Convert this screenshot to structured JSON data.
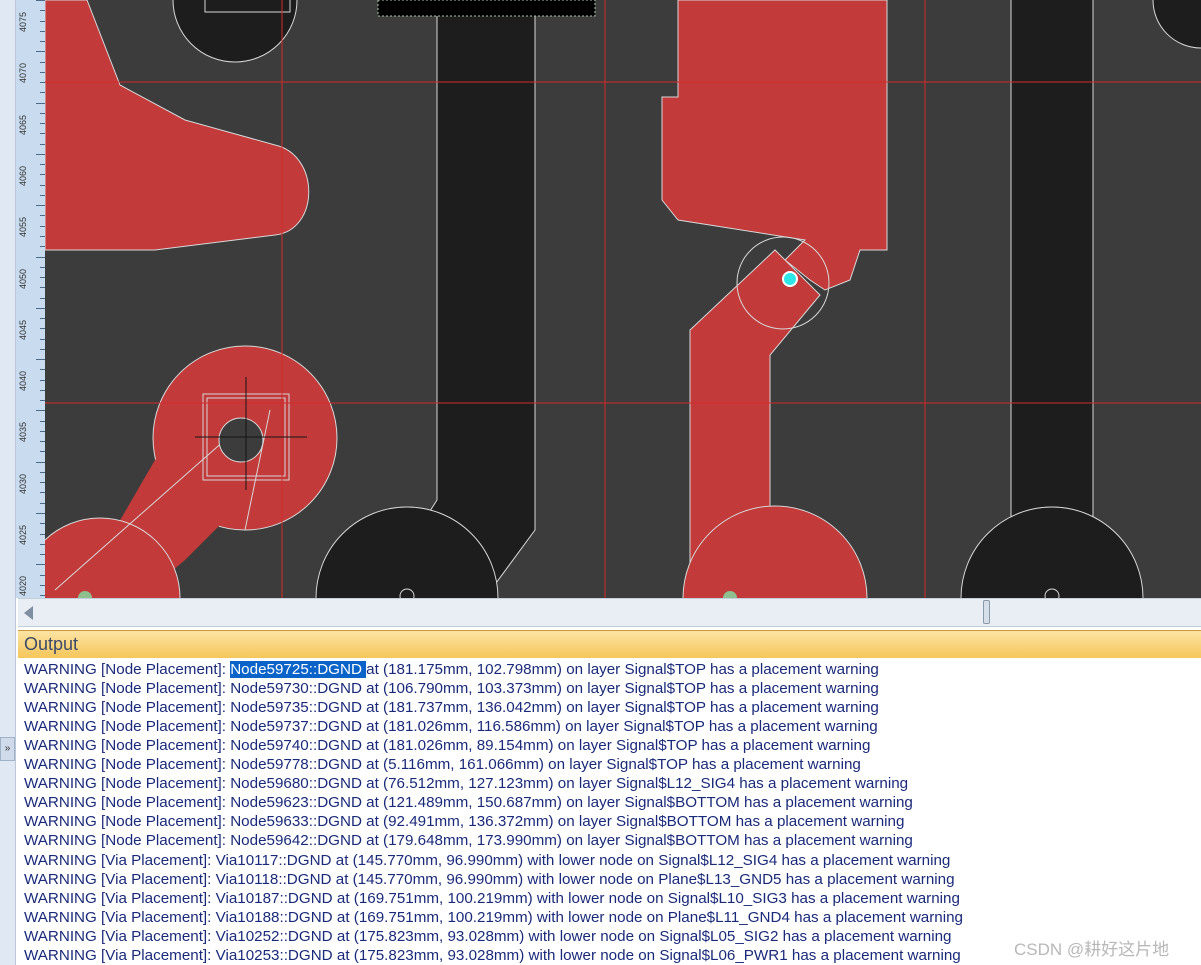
{
  "ruler": {
    "labels": [
      "4075",
      "4070",
      "4065",
      "4060",
      "4055",
      "4050",
      "4045",
      "4040",
      "4035",
      "4030",
      "4025",
      "4020"
    ]
  },
  "colors": {
    "board": "#3c3c3c",
    "copper_top": "#c23a3a",
    "copper_other": "#1d1d1d",
    "grid": "#d42a2a",
    "outline": "#d8d8d8",
    "via_marker": "#2ee6e6",
    "selection": "#0a63c9"
  },
  "output": {
    "title": "Output",
    "selected_text": "Node59725::DGND",
    "lines": [
      {
        "pre": "WARNING [Node Placement]: ",
        "sel": "Node59725::DGND ",
        "post": "at (181.175mm, 102.798mm) on layer Signal$TOP has a placement warning"
      },
      {
        "pre": "",
        "sel": "",
        "post": "WARNING [Node Placement]: Node59730::DGND at (106.790mm, 103.373mm) on layer Signal$TOP has a placement warning"
      },
      {
        "pre": "",
        "sel": "",
        "post": "WARNING [Node Placement]: Node59735::DGND at (181.737mm, 136.042mm) on layer Signal$TOP has a placement warning"
      },
      {
        "pre": "",
        "sel": "",
        "post": "WARNING [Node Placement]: Node59737::DGND at (181.026mm, 116.586mm) on layer Signal$TOP has a placement warning"
      },
      {
        "pre": "",
        "sel": "",
        "post": "WARNING [Node Placement]: Node59740::DGND at (181.026mm, 89.154mm) on layer Signal$TOP has a placement warning"
      },
      {
        "pre": "",
        "sel": "",
        "post": "WARNING [Node Placement]: Node59778::DGND at (5.116mm, 161.066mm) on layer Signal$TOP has a placement warning"
      },
      {
        "pre": "",
        "sel": "",
        "post": "WARNING [Node Placement]: Node59680::DGND at (76.512mm, 127.123mm) on layer Signal$L12_SIG4 has a placement warning"
      },
      {
        "pre": "",
        "sel": "",
        "post": "WARNING [Node Placement]: Node59623::DGND at (121.489mm, 150.687mm) on layer Signal$BOTTOM has a placement warning"
      },
      {
        "pre": "",
        "sel": "",
        "post": "WARNING [Node Placement]: Node59633::DGND at (92.491mm, 136.372mm) on layer Signal$BOTTOM has a placement warning"
      },
      {
        "pre": "",
        "sel": "",
        "post": "WARNING [Node Placement]: Node59642::DGND at (179.648mm, 173.990mm) on layer Signal$BOTTOM has a placement warning"
      },
      {
        "pre": "",
        "sel": "",
        "post": "WARNING [Via Placement]: Via10117::DGND at (145.770mm, 96.990mm) with lower node on Signal$L12_SIG4 has a  placement warning"
      },
      {
        "pre": "",
        "sel": "",
        "post": "WARNING [Via Placement]: Via10118::DGND at (145.770mm, 96.990mm) with lower node on Plane$L13_GND5 has a  placement warning"
      },
      {
        "pre": "",
        "sel": "",
        "post": "WARNING [Via Placement]: Via10187::DGND at (169.751mm, 100.219mm) with lower node on Signal$L10_SIG3 has a  placement warning"
      },
      {
        "pre": "",
        "sel": "",
        "post": "WARNING [Via Placement]: Via10188::DGND at (169.751mm, 100.219mm) with lower node on Plane$L11_GND4 has a  placement warning"
      },
      {
        "pre": "",
        "sel": "",
        "post": "WARNING [Via Placement]: Via10252::DGND at (175.823mm, 93.028mm) with lower node on Signal$L05_SIG2 has a  placement warning"
      },
      {
        "pre": "",
        "sel": "",
        "post": "WARNING [Via Placement]: Via10253::DGND at (175.823mm, 93.028mm) with lower node on Signal$L06_PWR1 has a  placement warning"
      }
    ]
  },
  "icons": {
    "collapse": "double-chevron-down-icon",
    "scroll_left": "triangle-left-icon"
  },
  "watermark": "CSDN @耕好这片地"
}
